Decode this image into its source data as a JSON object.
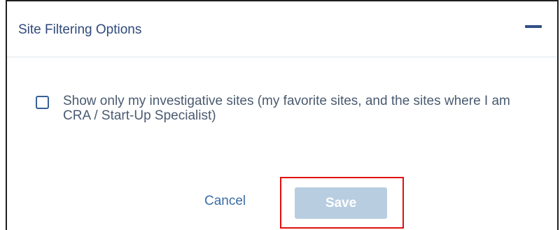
{
  "panel": {
    "title": "Site Filtering Options",
    "collapse_icon": "minus-icon"
  },
  "option": {
    "checked": false,
    "label": "Show only my investigative sites (my favorite sites, and the sites where I am CRA / Start-Up Specialist)"
  },
  "actions": {
    "cancel_label": "Cancel",
    "save_label": "Save",
    "save_disabled": true
  },
  "colors": {
    "title_text": "#2f4a7a",
    "link": "#3b6ea5",
    "save_disabled_bg": "#b8cde0",
    "highlight": "#e01010"
  }
}
